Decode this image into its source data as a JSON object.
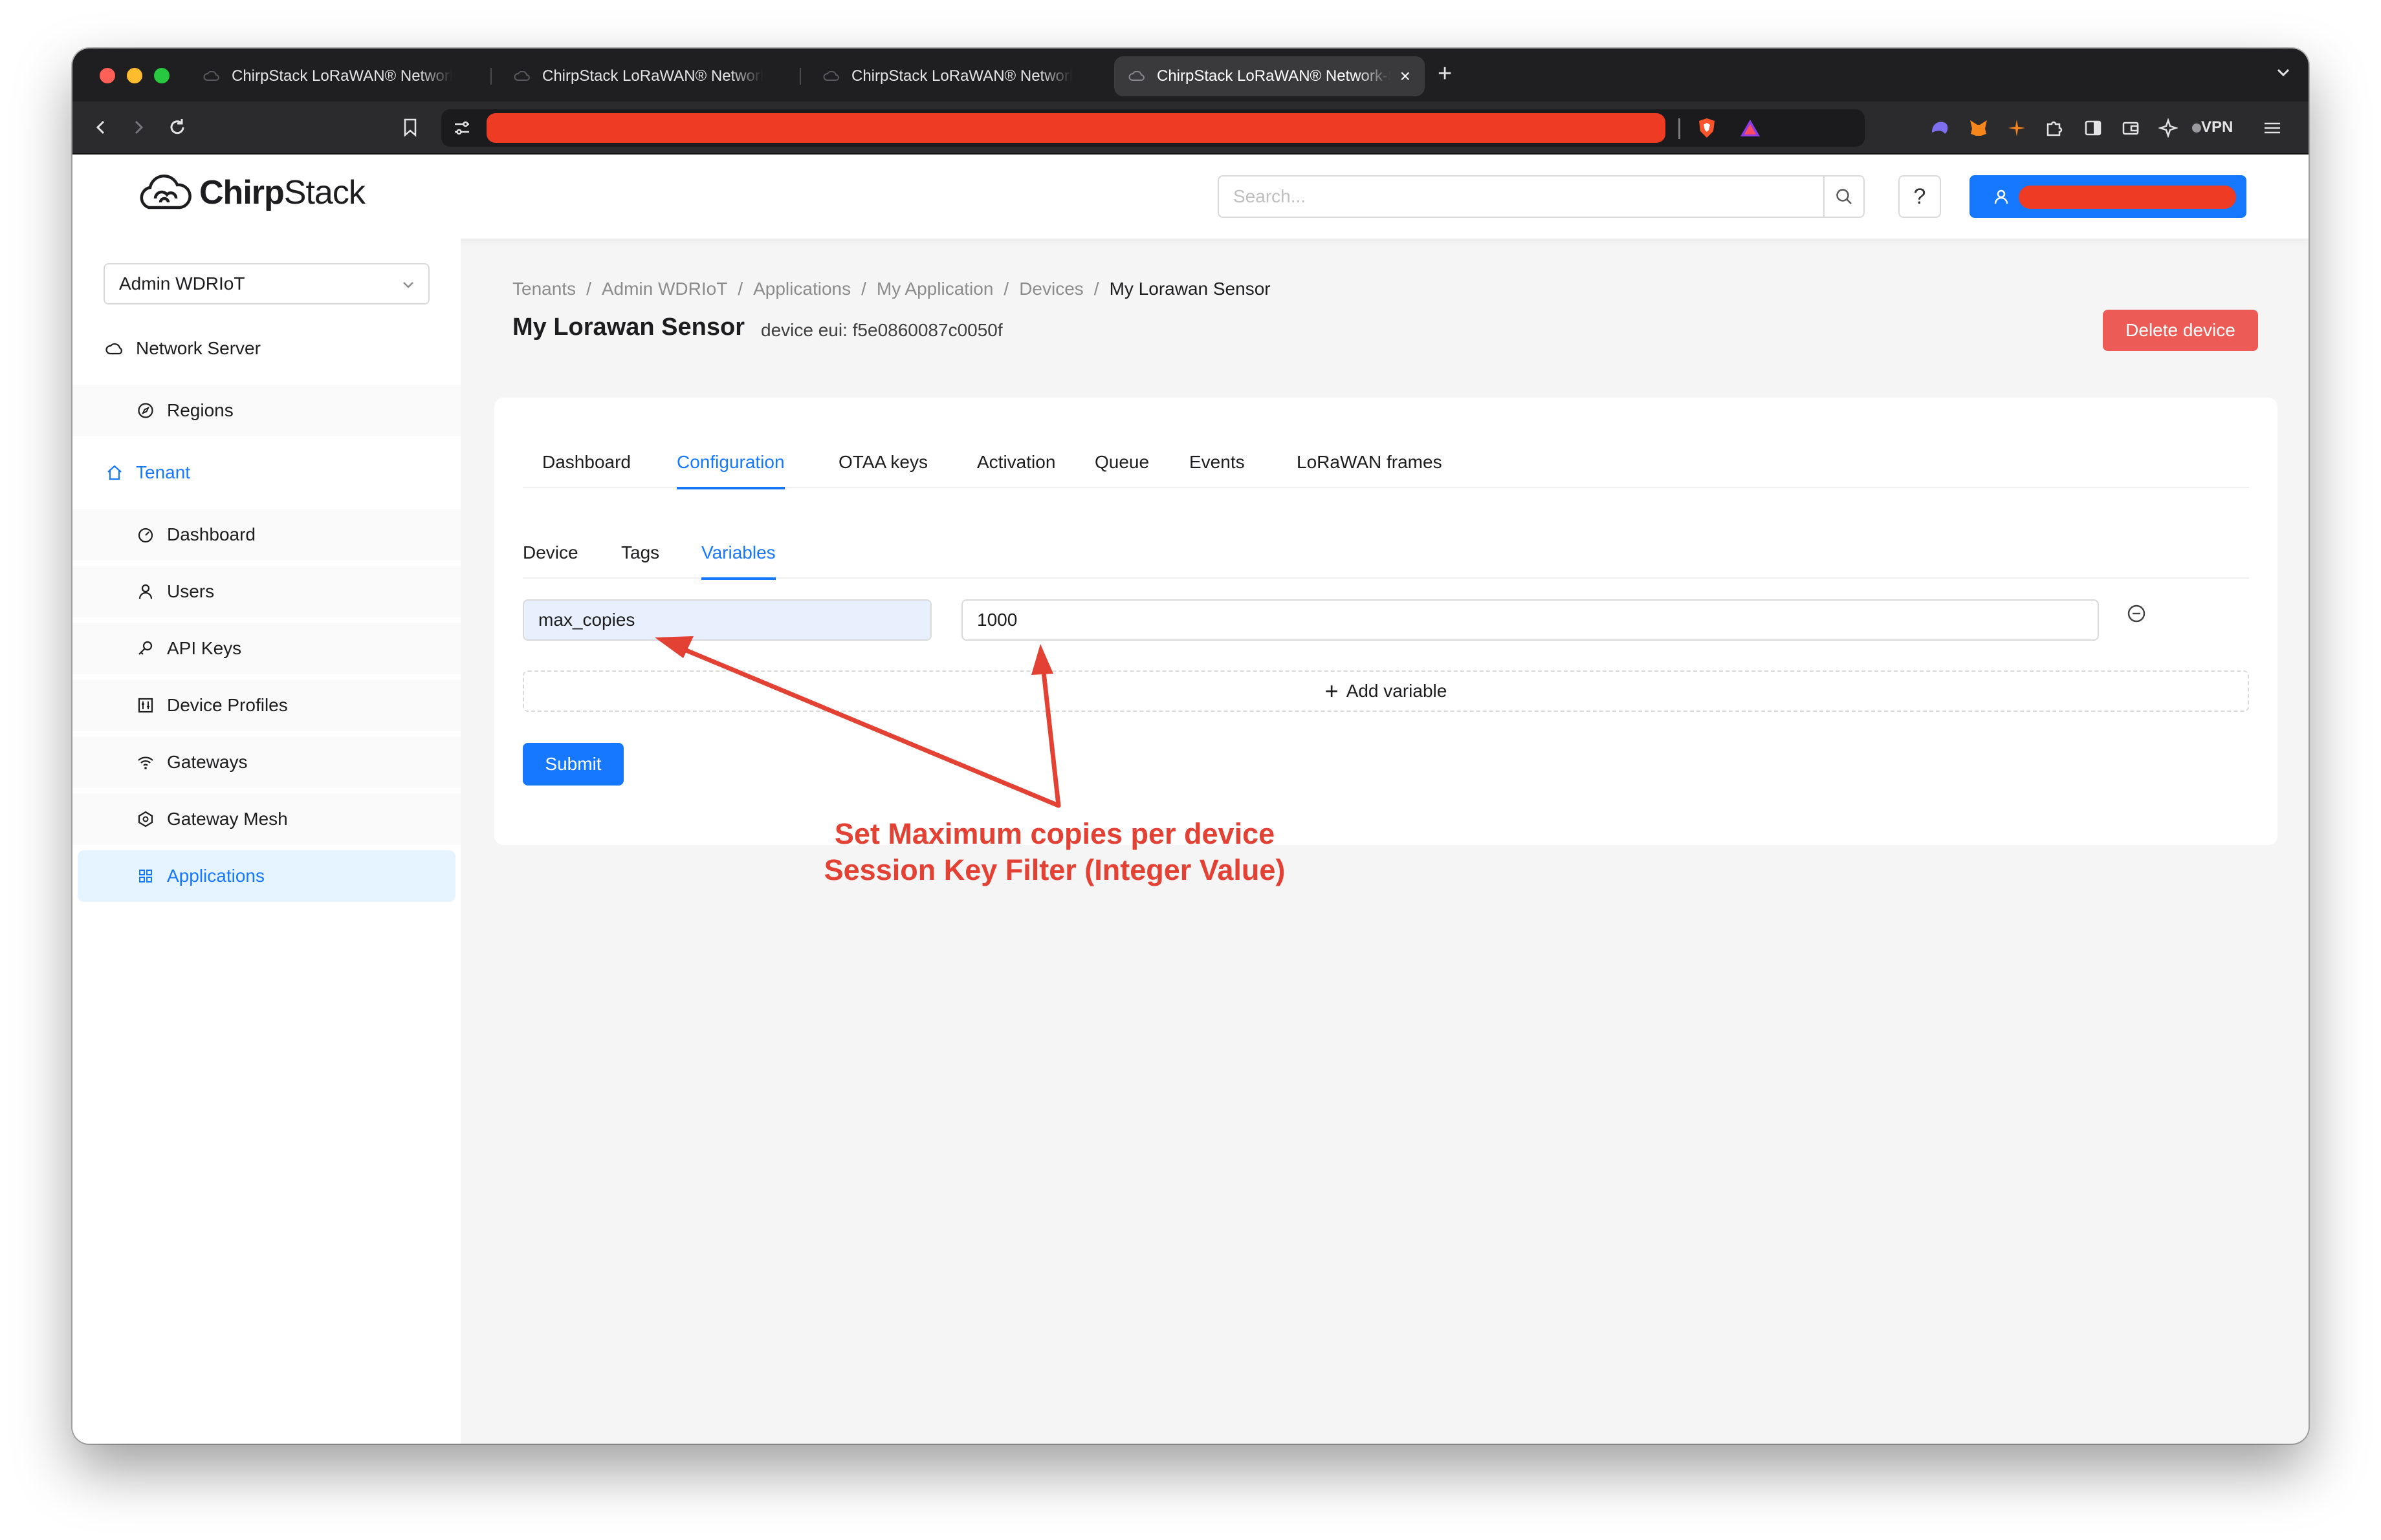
{
  "browser": {
    "tabs": [
      {
        "title": "ChirpStack LoRaWAN® Network-Server",
        "active": false
      },
      {
        "title": "ChirpStack LoRaWAN® Network-Server",
        "active": false
      },
      {
        "title": "ChirpStack LoRaWAN® Network-Server",
        "active": false
      },
      {
        "title": "ChirpStack LoRaWAN® Network-Server",
        "active": true
      }
    ],
    "new_tab_label": "+",
    "close_tab_label": "×",
    "vpn_label": "VPN"
  },
  "header": {
    "logo_part1": "Chirp",
    "logo_part2": "Stack",
    "search_placeholder": "Search...",
    "help_label": "?"
  },
  "sidebar": {
    "tenant_select_value": "Admin WDRIoT",
    "items": [
      {
        "label": "Network Server",
        "icon": "cloud-icon"
      },
      {
        "label": "Regions",
        "icon": "compass-icon"
      },
      {
        "label": "Tenant",
        "icon": "home-icon"
      },
      {
        "label": "Dashboard",
        "icon": "dashboard-icon"
      },
      {
        "label": "Users",
        "icon": "user-icon"
      },
      {
        "label": "API Keys",
        "icon": "key-icon"
      },
      {
        "label": "Device Profiles",
        "icon": "control-icon"
      },
      {
        "label": "Gateways",
        "icon": "wifi-icon"
      },
      {
        "label": "Gateway Mesh",
        "icon": "mesh-icon"
      },
      {
        "label": "Applications",
        "icon": "appstore-icon"
      }
    ],
    "selected": "Applications"
  },
  "breadcrumb": [
    "Tenants",
    "Admin WDRIoT",
    "Applications",
    "My Application",
    "Devices",
    "My Lorawan Sensor"
  ],
  "breadcrumb_separator": "/",
  "page": {
    "title": "My Lorawan Sensor",
    "subtitle": "device eui: f5e0860087c0050f",
    "delete_label": "Delete device"
  },
  "tabs": [
    "Dashboard",
    "Configuration",
    "OTAA keys",
    "Activation",
    "Queue",
    "Events",
    "LoRaWAN frames"
  ],
  "active_tab": "Configuration",
  "subtabs": [
    "Device",
    "Tags",
    "Variables"
  ],
  "active_subtab": "Variables",
  "variable": {
    "name": "max_copies",
    "value": "1000"
  },
  "add_variable_label": "Add variable",
  "submit_label": "Submit",
  "annotation": {
    "line1": "Set Maximum copies per device",
    "line2": "Session Key Filter (Integer Value)",
    "color": "#e34133"
  },
  "colors": {
    "primary": "#1677ff",
    "danger": "#ec5b55",
    "redaction": "#ee3b24"
  }
}
